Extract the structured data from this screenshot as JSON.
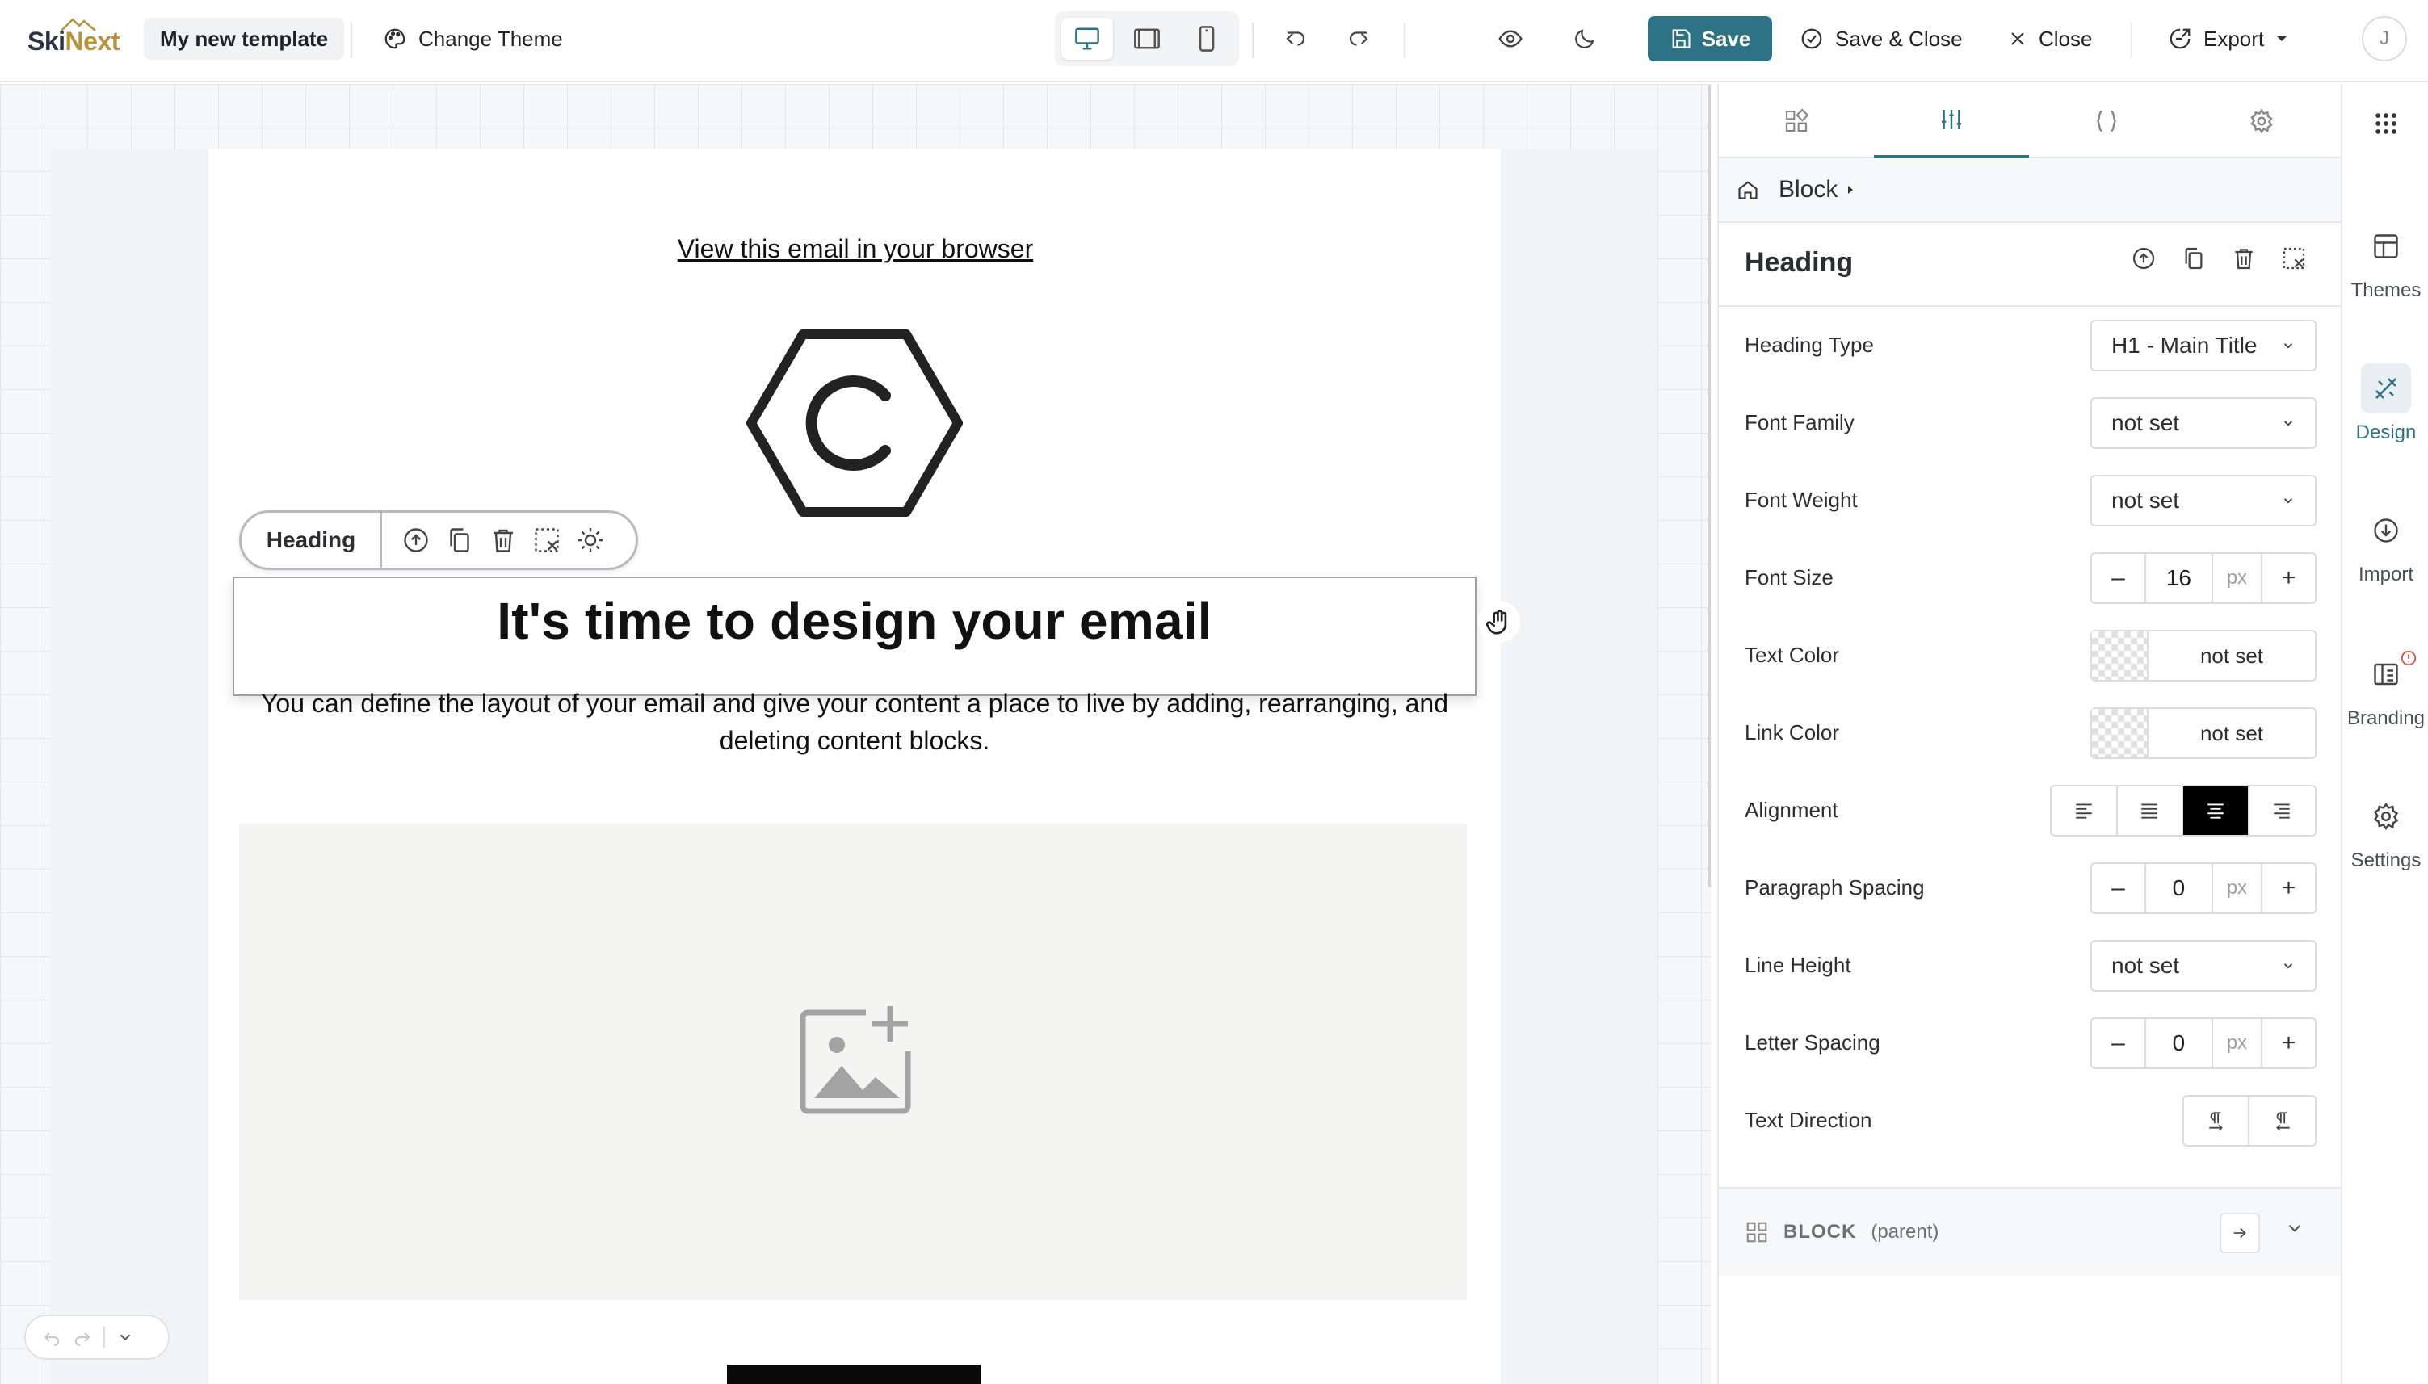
{
  "app": {
    "brand_part1": "Ski",
    "brand_part2": "Next",
    "template_name": "My new template",
    "change_theme": "Change Theme",
    "save": "Save",
    "save_close": "Save & Close",
    "close": "Close",
    "export": "Export",
    "avatar_initial": "J",
    "accent": "#2e7385"
  },
  "devices": {
    "active": "desktop",
    "items": [
      "desktop",
      "tablet",
      "mobile"
    ]
  },
  "canvas": {
    "view_in_browser": "View this email in your browser",
    "heading_toolbar_label": "Heading",
    "heading_text": "It's time to design your email",
    "paragraph": "You can define the layout of your email and give your content a place to live by adding, rearranging, and deleting content blocks."
  },
  "panel": {
    "breadcrumb": "Block",
    "title": "Heading",
    "fields": {
      "heading_type": {
        "label": "Heading Type",
        "value": "H1 - Main Title"
      },
      "font_family": {
        "label": "Font Family",
        "value": "not set"
      },
      "font_weight": {
        "label": "Font Weight",
        "value": "not set"
      },
      "font_size": {
        "label": "Font Size",
        "value": "16",
        "unit": "px"
      },
      "text_color": {
        "label": "Text Color",
        "value": "not set"
      },
      "link_color": {
        "label": "Link Color",
        "value": "not set"
      },
      "alignment": {
        "label": "Alignment",
        "selected": "center"
      },
      "paragraph_spacing": {
        "label": "Paragraph Spacing",
        "value": "0",
        "unit": "px"
      },
      "line_height": {
        "label": "Line Height",
        "value": "not set"
      },
      "letter_spacing": {
        "label": "Letter Spacing",
        "value": "0",
        "unit": "px"
      },
      "text_direction": {
        "label": "Text Direction"
      }
    },
    "parent": {
      "title": "BLOCK",
      "subtitle": "(parent)"
    }
  },
  "rail": {
    "themes": "Themes",
    "design": "Design",
    "import": "Import",
    "branding": "Branding",
    "settings": "Settings"
  }
}
